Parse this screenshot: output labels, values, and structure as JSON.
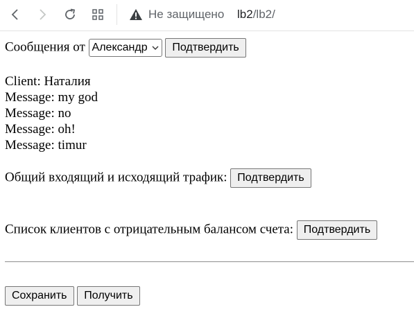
{
  "browser": {
    "not_secure_label": "Не защищено",
    "url_host": "lb2",
    "url_path": "/lb2/"
  },
  "filter": {
    "label": "Сообщения от",
    "selected_client": "Александр",
    "submit_label": "Подтвердить"
  },
  "messages": {
    "client_line": "Client: Наталия",
    "items": [
      "Message: my god",
      "Message: no",
      "Message: oh!",
      "Message: timur"
    ]
  },
  "traffic": {
    "label": "Общий входящий и исходящий трафик:",
    "submit_label": "Подтвердить"
  },
  "negative_balance": {
    "label": "Список клиентов с отрицательным балансом счета:",
    "submit_label": "Подтвердить"
  },
  "actions": {
    "save_label": "Сохранить",
    "get_label": "Получить"
  }
}
